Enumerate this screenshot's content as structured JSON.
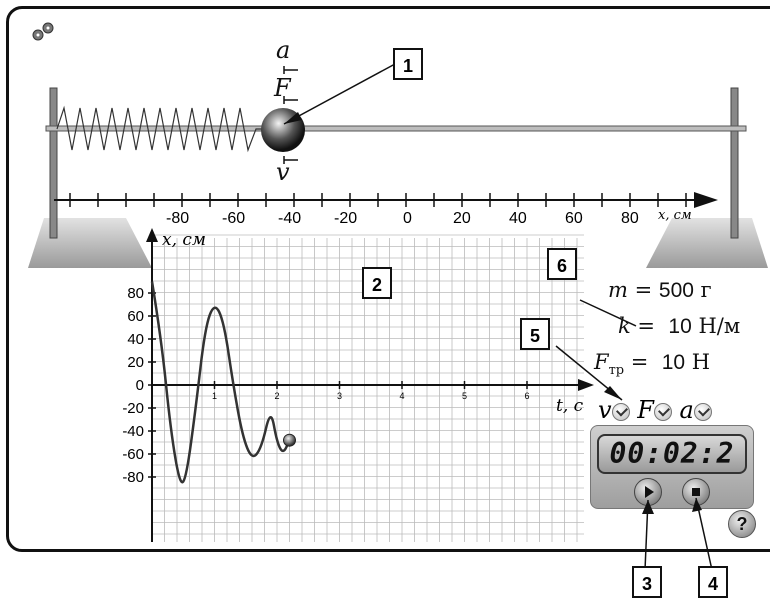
{
  "callouts": [
    "1",
    "2",
    "3",
    "4",
    "5",
    "6"
  ],
  "ruler": {
    "ticks": [
      "-80",
      "-60",
      "-40",
      "-20",
      "0",
      "20",
      "40",
      "60",
      "80"
    ],
    "unit_label": "x, см"
  },
  "vectors": {
    "a": "a",
    "F": "F",
    "v": "v"
  },
  "graph": {
    "y_axis_label": "x, см",
    "x_axis_label": "t, с",
    "y_ticks": [
      "80",
      "60",
      "40",
      "20",
      "0",
      "-20",
      "-40",
      "-60",
      "-80"
    ],
    "x_ticks": [
      "1",
      "2",
      "3",
      "4",
      "5",
      "6"
    ]
  },
  "chart_data": {
    "type": "line",
    "xlabel": "t, с",
    "ylabel": "x, см",
    "xlim": [
      0,
      6.8
    ],
    "ylim": [
      -90,
      90
    ],
    "series": [
      {
        "x": [
          0,
          0.15,
          0.3,
          0.45,
          0.55,
          0.7,
          0.85,
          1.0,
          1.15,
          1.3,
          1.45,
          1.6,
          1.75,
          1.9,
          2.0,
          2.1,
          2.2
        ],
        "values": [
          90,
          40,
          -40,
          -88,
          -80,
          -20,
          50,
          72,
          55,
          0,
          -45,
          -65,
          -55,
          -20,
          -50,
          -60,
          -48
        ]
      }
    ]
  },
  "params": {
    "m_label": "m",
    "m_eq": "=",
    "m_value": "500",
    "m_unit": "г",
    "k_label": "k",
    "k_eq": "=",
    "k_value": "10",
    "k_unit": "Н/м",
    "f_label": "F",
    "f_sub": "тр",
    "f_eq": "=",
    "f_value": "10",
    "f_unit": "Н"
  },
  "toggles": {
    "v": "v",
    "F": "F",
    "a": "a"
  },
  "timer": {
    "display": "00:02:2"
  },
  "help": "?"
}
